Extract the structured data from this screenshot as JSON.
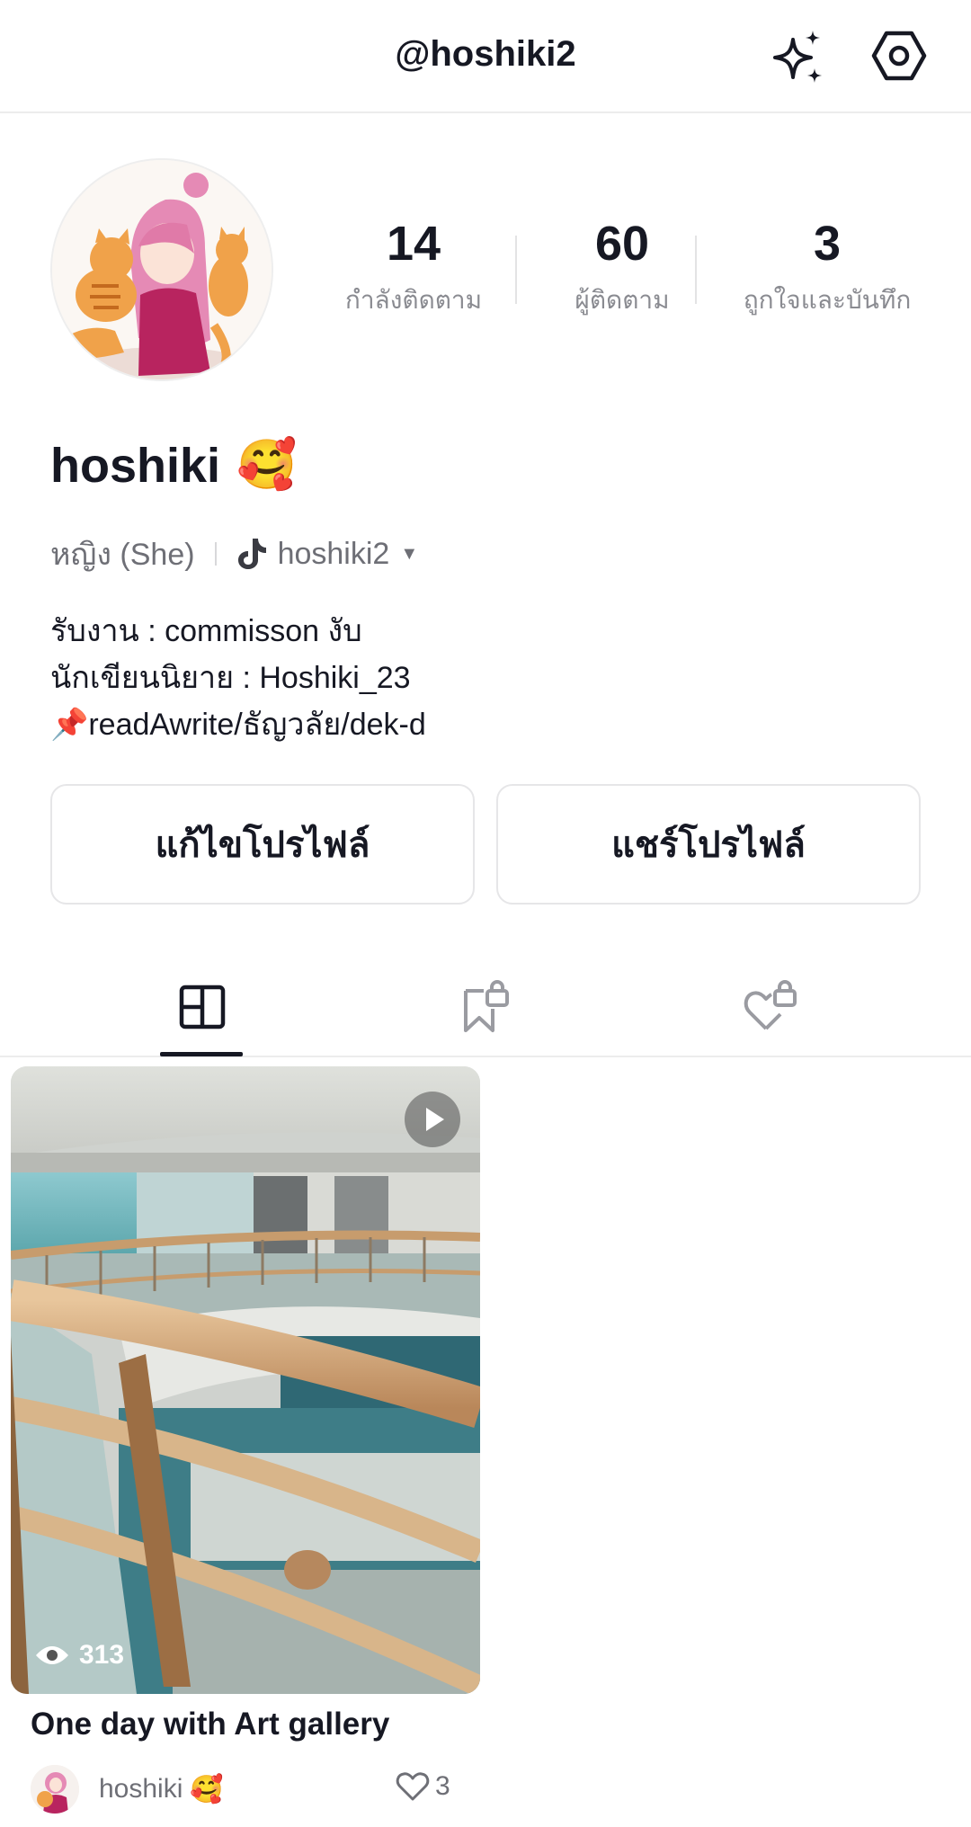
{
  "header": {
    "handle": "@hoshiki2",
    "icons": [
      "sparkle-icon",
      "settings-icon"
    ]
  },
  "profile": {
    "name": "hoshiki",
    "name_emoji": "🥰",
    "gender": "หญิง (She)",
    "tiktok_handle": "hoshiki2",
    "stats": [
      {
        "value": "14",
        "label": "กำลังติดตาม"
      },
      {
        "value": "60",
        "label": "ผู้ติดตาม"
      },
      {
        "value": "3",
        "label": "ถูกใจและบันทึก"
      }
    ],
    "bio": [
      "รับงาน : commisson งับ",
      "นักเขียนนิยาย : Hoshiki_23",
      "📌readAwrite/ธัญวลัย/dek-d"
    ]
  },
  "buttons": {
    "edit_profile": "แก้ไขโปรไฟล์",
    "share_profile": "แชร์โปรไฟล์"
  },
  "tabs": [
    {
      "icon": "grid-icon",
      "active": true
    },
    {
      "icon": "bookmark-lock-icon",
      "active": false
    },
    {
      "icon": "heart-lock-icon",
      "active": false
    }
  ],
  "posts": [
    {
      "title": "One day with Art gallery",
      "views": "313",
      "author": "hoshiki",
      "author_emoji": "🥰",
      "likes": "3"
    }
  ]
}
